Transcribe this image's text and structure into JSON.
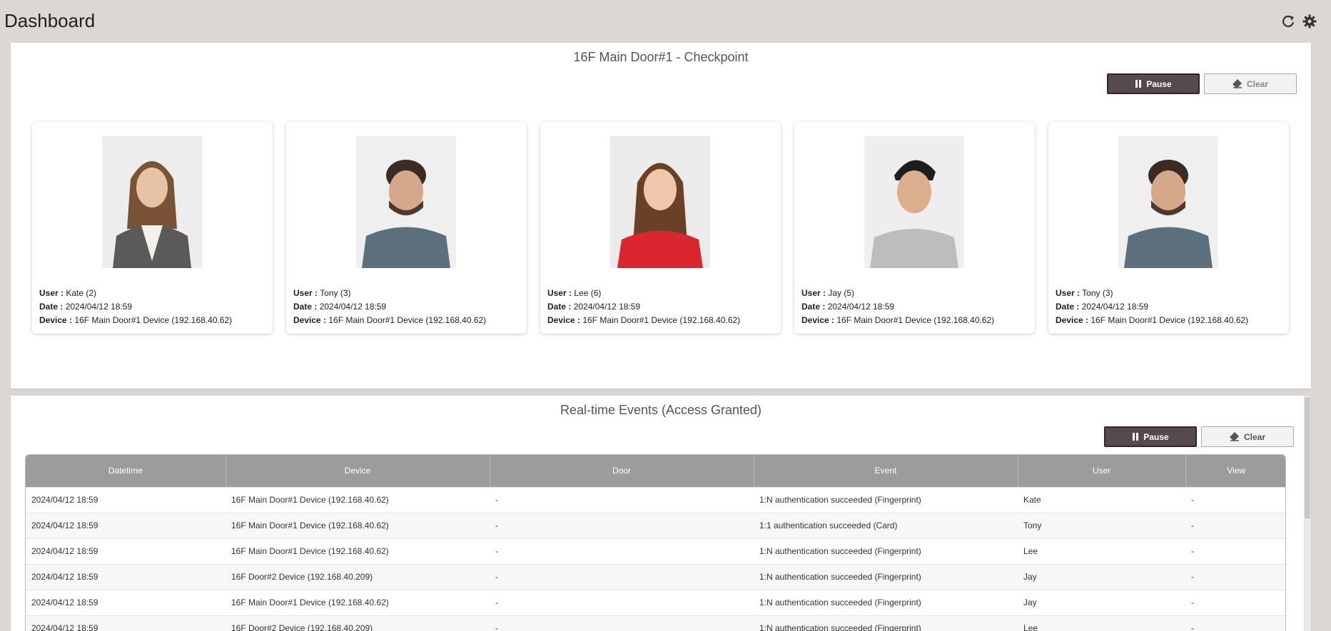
{
  "header": {
    "title": "Dashboard",
    "refresh_icon": "refresh-icon",
    "settings_icon": "gear-icon"
  },
  "checkpoint": {
    "title": "16F Main Door#1 - Checkpoint",
    "pause_label": "Pause",
    "clear_label": "Clear",
    "user_label": "User :",
    "date_label": "Date :",
    "device_label": "Device :",
    "cards": [
      {
        "user": "Kate (2)",
        "date": "2024/04/12 18:59",
        "device": "16F Main Door#1 Device (192.168.40.62)"
      },
      {
        "user": "Tony (3)",
        "date": "2024/04/12 18:59",
        "device": "16F Main Door#1 Device (192.168.40.62)"
      },
      {
        "user": "Lee (6)",
        "date": "2024/04/12 18:59",
        "device": "16F Main Door#1 Device (192.168.40.62)"
      },
      {
        "user": "Jay (5)",
        "date": "2024/04/12 18:59",
        "device": "16F Main Door#1 Device (192.168.40.62)"
      },
      {
        "user": "Tony (3)",
        "date": "2024/04/12 18:59",
        "device": "16F Main Door#1 Device (192.168.40.62)"
      }
    ]
  },
  "events": {
    "title": "Real-time Events (Access Granted)",
    "pause_label": "Pause",
    "clear_label": "Clear",
    "columns": [
      "Datetime",
      "Device",
      "Door",
      "Event",
      "User",
      "View"
    ],
    "rows": [
      [
        "2024/04/12 18:59",
        "16F Main Door#1 Device (192.168.40.62)",
        "-",
        "1:N authentication succeeded (Fingerprint)",
        "Kate",
        "-"
      ],
      [
        "2024/04/12 18:59",
        "16F Main Door#1 Device (192.168.40.62)",
        "-",
        "1:1 authentication succeeded (Card)",
        "Tony",
        "-"
      ],
      [
        "2024/04/12 18:59",
        "16F Main Door#1 Device (192.168.40.62)",
        "-",
        "1:N authentication succeeded (Fingerprint)",
        "Lee",
        "-"
      ],
      [
        "2024/04/12 18:59",
        "16F Door#2 Device (192.168.40.209)",
        "-",
        "1:N authentication succeeded (Fingerprint)",
        "Jay",
        "-"
      ],
      [
        "2024/04/12 18:59",
        "16F Main Door#1 Device (192.168.40.62)",
        "-",
        "1:N authentication succeeded (Fingerprint)",
        "Jay",
        "-"
      ],
      [
        "2024/04/12 18:59",
        "16F Door#2 Device (192.168.40.209)",
        "-",
        "1:N authentication succeeded (Fingerprint)",
        "Lee",
        "-"
      ]
    ]
  },
  "colors": {
    "pause_button": "#574a4d",
    "table_header": "#9c9c9c",
    "background": "#dcd7d3",
    "photo_colors": [
      "#5a5a5a",
      "#5c6f7c",
      "#d9262f",
      "#bdbdbd",
      "#5c6f7c"
    ]
  }
}
